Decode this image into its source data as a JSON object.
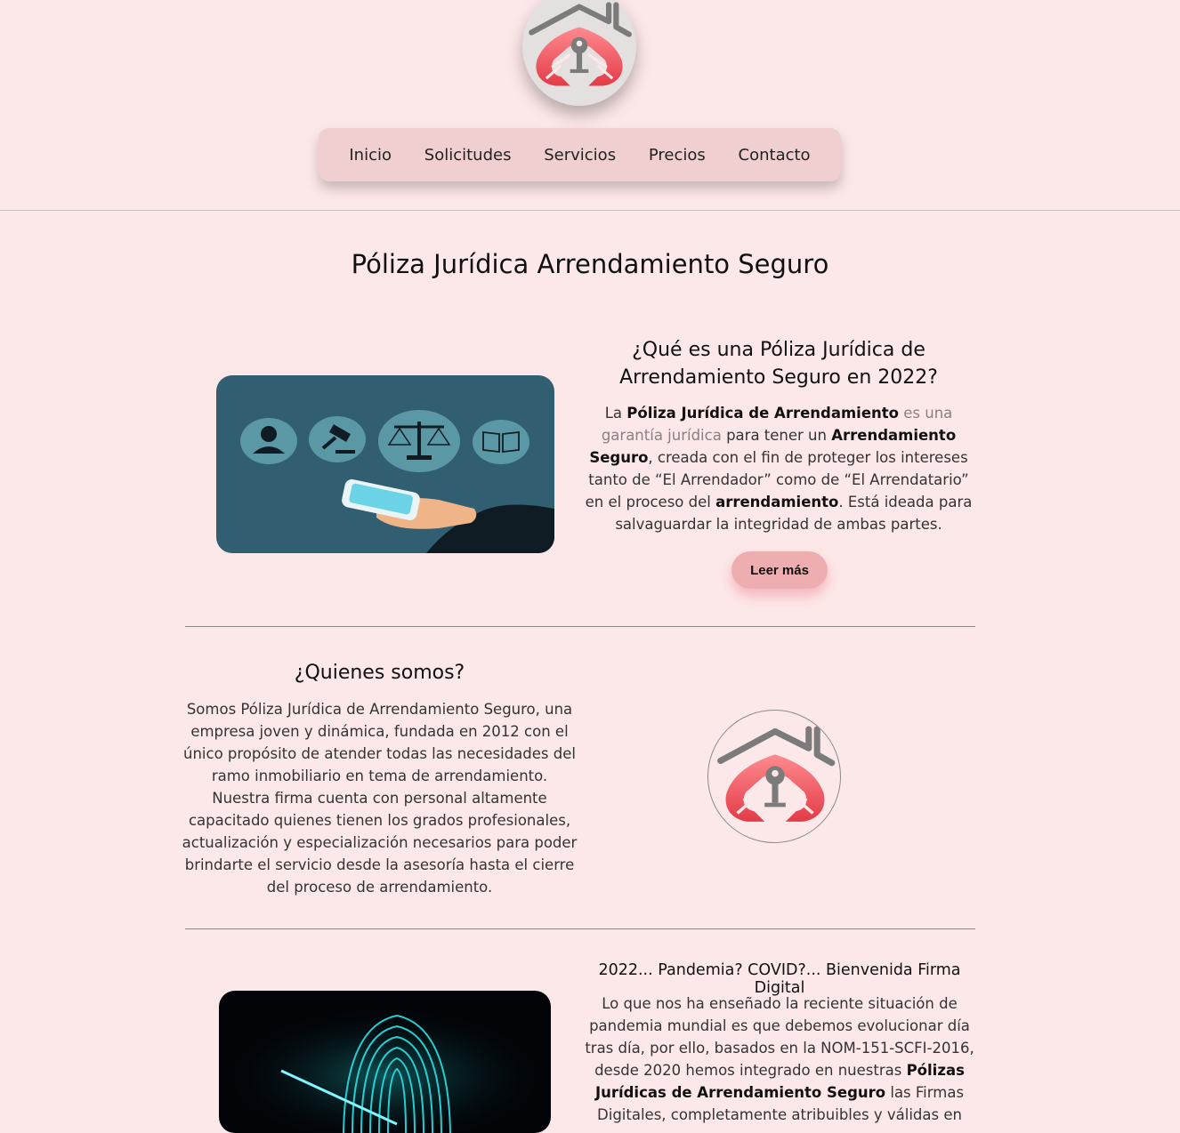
{
  "nav": {
    "items": [
      "Inicio",
      "Solicitudes",
      "Servicios",
      "Precios",
      "Contacto"
    ]
  },
  "page": {
    "title": "Póliza Jurídica Arrendamiento Seguro"
  },
  "section1": {
    "title_line1": "¿Qué es una  Póliza Jurídica de",
    "title_line2": "Arrendamiento Seguro en 2022?",
    "p_la": "La ",
    "p_b1": "Póliza Jurídica de Arrendamiento",
    "p_muted": " es una garantía jurídica",
    "p_t1": " para tener un ",
    "p_b2": "Arrendamiento Seguro",
    "p_t2": ", creada con el fin de proteger los intereses tanto de “El Arrendador” como de “El Arrendatario” en el proceso del ",
    "p_b3": "arrendamiento",
    "p_t3": ".  Está ideada para salvaguardar la integridad de ambas partes.",
    "button_label": "Leer más"
  },
  "section2": {
    "title": "¿Quienes somos?",
    "text": "Somos  Póliza Jurídica de Arrendamiento Seguro, una empresa joven y dinámica, fundada en 2012 con el único propósito de atender todas las necesidades del ramo inmobiliario en tema de arrendamiento. Nuestra firma cuenta con personal altamente capacitado quienes tienen los grados profesionales, actualización y especialización necesarios para poder brindarte el servicio desde la asesoría hasta el cierre del proceso de arrendamiento."
  },
  "section3": {
    "title": "2022... Pandemia? COVID?... Bienvenida Firma Digital",
    "p_t1": "Lo que nos ha enseñado la reciente situación de pandemia mundial es que debemos evolucionar día tras día, por ello, basados en la  NOM-151-SCFI-2016, desde 2020 hemos integrado en nuestras ",
    "p_b1": "Pólizas Jurídicas de Arrendamiento Seguro",
    "p_t2": " las  Firmas Digitales, completamente atribuibles y válidas en"
  },
  "colors": {
    "background": "#fde8e9",
    "nav_bg": "#f0cfd0",
    "button_bg": "#eeadb1",
    "logo_red": "#ee4a55",
    "logo_gray": "#7b7b7b",
    "image_teal": "#325e72",
    "fingerprint_cyan": "#28e3e6"
  },
  "icons": [
    "logo-house-key-icon",
    "user-icon",
    "gavel-icon",
    "scales-icon",
    "book-icon",
    "phone-hand-icon",
    "fingerprint-icon"
  ]
}
